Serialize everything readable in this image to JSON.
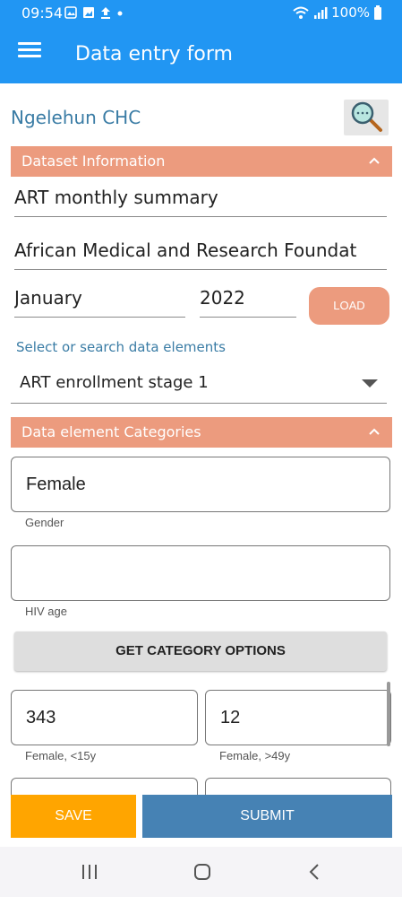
{
  "status_bar": {
    "time": "09:54",
    "battery": "100%",
    "icons": [
      "gallery-icon",
      "image-icon",
      "upload-icon",
      "dot-icon",
      "wifi-icon",
      "signal-icon",
      "battery-icon"
    ]
  },
  "app_bar": {
    "title": "Data entry form",
    "menu_icon": "menu-icon",
    "color": "#2196f3"
  },
  "org_unit": {
    "name": "Ngelehun CHC",
    "search_icon": "magnifier-icon"
  },
  "dataset_section": {
    "header": "Dataset Information",
    "dataset": "ART monthly summary",
    "category_option": "African Medical and Research Foundat",
    "period_month": "January",
    "period_year": "2022",
    "load_label": "LOAD"
  },
  "data_element": {
    "hint": "Select or search data elements",
    "selected": "ART enrollment stage 1"
  },
  "categories_section": {
    "header": "Data element Categories",
    "gender_value": "Female",
    "gender_label": "Gender",
    "hiv_age_value": "",
    "hiv_age_label": "HIV age",
    "get_options_label": "GET CATEGORY OPTIONS"
  },
  "values": [
    {
      "value": "343",
      "label": "Female, <15y"
    },
    {
      "value": "12",
      "label": "Female, >49y"
    }
  ],
  "actions": {
    "save_label": "SAVE",
    "submit_label": "SUBMIT"
  },
  "colors": {
    "primary": "#2196f3",
    "section": "#ec9b7e",
    "save": "#ffa500",
    "submit": "#4682b4",
    "org_text": "#3a7ca5"
  }
}
